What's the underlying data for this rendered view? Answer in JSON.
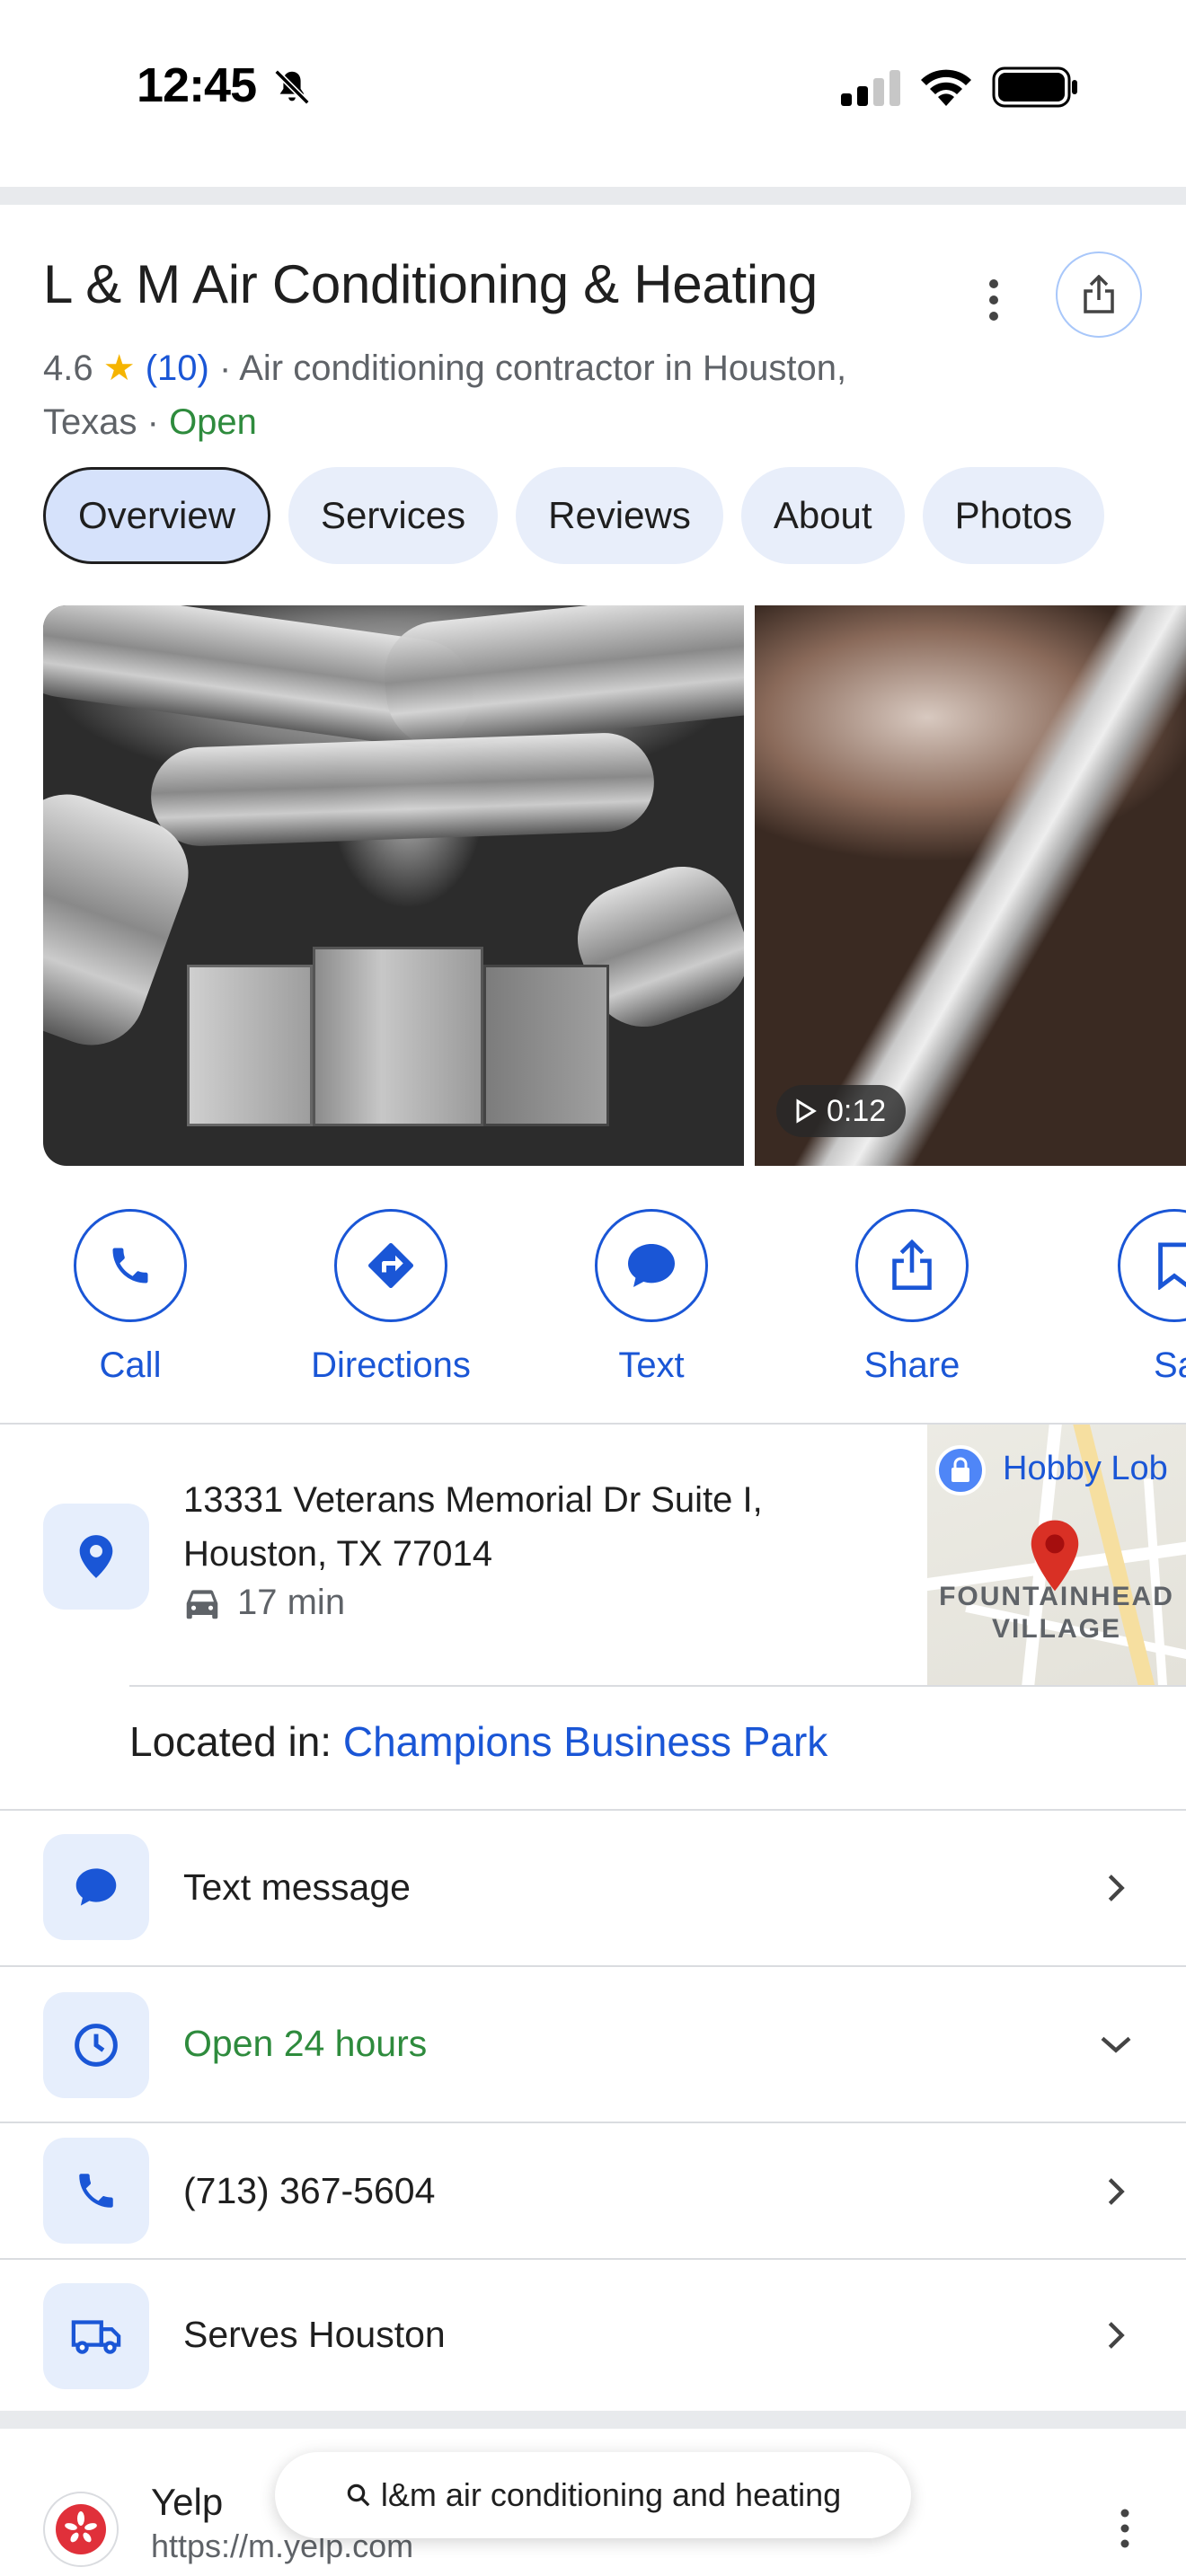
{
  "status_bar": {
    "time": "12:45"
  },
  "business": {
    "name": "L & M Air Conditioning & Heating",
    "rating": "4.6",
    "review_count": "(10)",
    "category": "Air conditioning contractor in Houston, Texas",
    "status": "Open"
  },
  "tabs": [
    {
      "label": "Overview",
      "active": true
    },
    {
      "label": "Services",
      "active": false
    },
    {
      "label": "Reviews",
      "active": false
    },
    {
      "label": "About",
      "active": false
    },
    {
      "label": "Photos",
      "active": false
    }
  ],
  "media": {
    "video_duration": "0:12"
  },
  "actions": [
    {
      "label": "Call",
      "icon": "phone-icon"
    },
    {
      "label": "Directions",
      "icon": "directions-icon"
    },
    {
      "label": "Text",
      "icon": "chat-bubble-icon"
    },
    {
      "label": "Share",
      "icon": "share-icon"
    },
    {
      "label": "Sav",
      "icon": "bookmark-icon"
    }
  ],
  "address": {
    "line1": "13331 Veterans Memorial Dr Suite I,",
    "line2": "Houston, TX 77014",
    "drive_time": "17 min"
  },
  "map": {
    "poi_label": "Hobby Lob",
    "area_line1": "FOUNTAINHEAD",
    "area_line2": "VILLAGE"
  },
  "located_in": {
    "prefix": "Located in:",
    "place": "Champions Business Park"
  },
  "info_rows": {
    "text_message": "Text message",
    "hours": "Open 24 hours",
    "phone": "(713) 367-5604",
    "serves": "Serves Houston"
  },
  "search_result": {
    "site_name": "Yelp",
    "url": "https://m.yelp.com"
  },
  "search_bar": {
    "query": "l&m air conditioning and heating"
  },
  "colors": {
    "accent_blue": "#1a56d6",
    "open_green": "#2e8b3d",
    "tile_bg": "#e6eefc",
    "star": "#f5b400"
  }
}
